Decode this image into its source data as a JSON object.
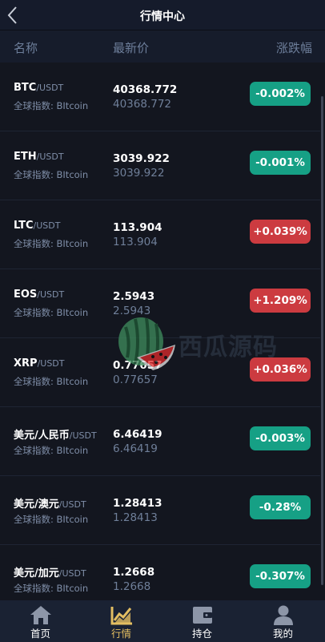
{
  "header": {
    "title": "行情中心"
  },
  "columns": {
    "name": "名称",
    "price": "最新价",
    "change": "涨跌幅"
  },
  "colors": {
    "up": "#cc3b40",
    "down": "#16a085",
    "active_tab": "#e3be62"
  },
  "rows": [
    {
      "symbol": "BTC",
      "quote": "/USDT",
      "index": "全球指数: BItcoin",
      "price": "40368.772",
      "price2": "40368.772",
      "change": "-0.002%",
      "direction": "down"
    },
    {
      "symbol": "ETH",
      "quote": "/USDT",
      "index": "全球指数: BItcoin",
      "price": "3039.922",
      "price2": "3039.922",
      "change": "-0.001%",
      "direction": "down"
    },
    {
      "symbol": "LTC",
      "quote": "/USDT",
      "index": "全球指数: BItcoin",
      "price": "113.904",
      "price2": "113.904",
      "change": "+0.039%",
      "direction": "up"
    },
    {
      "symbol": "EOS",
      "quote": "/USDT",
      "index": "全球指数: BItcoin",
      "price": "2.5943",
      "price2": "2.5943",
      "change": "+1.209%",
      "direction": "up"
    },
    {
      "symbol": "XRP",
      "quote": "/USDT",
      "index": "全球指数: BItcoin",
      "price": "0.77657",
      "price2": "0.77657",
      "change": "+0.036%",
      "direction": "up"
    },
    {
      "symbol": "美元/人民币",
      "quote": "/USDT",
      "index": "全球指数: BItcoin",
      "price": "6.46419",
      "price2": "6.46419",
      "change": "-0.003%",
      "direction": "down"
    },
    {
      "symbol": "美元/澳元",
      "quote": "/USDT",
      "index": "全球指数: BItcoin",
      "price": "1.28413",
      "price2": "1.28413",
      "change": "-0.28%",
      "direction": "down"
    },
    {
      "symbol": "美元/加元",
      "quote": "/USDT",
      "index": "全球指数: BItcoin",
      "price": "1.2668",
      "price2": "1.2668",
      "change": "-0.307%",
      "direction": "down"
    }
  ],
  "watermark": {
    "text": "西瓜源码"
  },
  "tabs": [
    {
      "label": "首页",
      "icon": "home-icon"
    },
    {
      "label": "行情",
      "icon": "chart-icon",
      "active": true
    },
    {
      "label": "持仓",
      "icon": "wallet-icon"
    },
    {
      "label": "我的",
      "icon": "user-icon"
    }
  ]
}
